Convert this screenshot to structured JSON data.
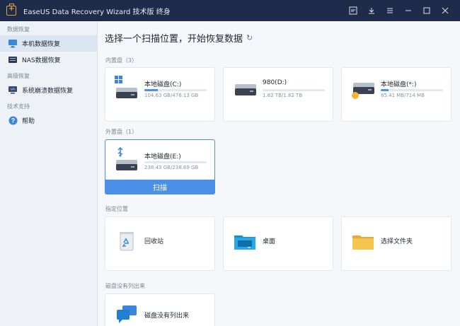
{
  "window": {
    "title": "EaseUS Data Recovery Wizard 技术版 终身",
    "accent": "#4a8fe8"
  },
  "sidebar": {
    "sections": [
      {
        "label": "数据恢复",
        "items": [
          {
            "label": "本机数据恢复",
            "icon": "monitor-icon",
            "active": true
          },
          {
            "label": "NAS数据恢复",
            "icon": "nas-icon",
            "active": false
          }
        ]
      },
      {
        "label": "高级恢复",
        "items": [
          {
            "label": "系统崩溃数据恢复",
            "icon": "pc-crash-icon",
            "active": false
          }
        ]
      },
      {
        "label": "技术支持",
        "items": [
          {
            "label": "帮助",
            "icon": "help-icon",
            "active": false
          }
        ]
      }
    ]
  },
  "main": {
    "title": "选择一个扫描位置，开始恢复数据",
    "internal_label": "内置盘（3）",
    "external_label": "外置盘（1）",
    "locations_label": "指定位置",
    "missing_label": "磁盘没有列出来",
    "scan_label": "扫描",
    "internal_drives": [
      {
        "name": "本地磁盘(C:)",
        "size": "104.63 GB/476.13 GB",
        "fill": 0.22,
        "icon": "windows-drive-icon"
      },
      {
        "name": "980(D:)",
        "size": "1.82 TB/1.82 TB",
        "fill": 0.0,
        "icon": "hdd-icon"
      },
      {
        "name": "本地磁盘(*:)",
        "size": "85.41 MB/714 MB",
        "fill": 0.12,
        "icon": "hdd-warning-icon"
      }
    ],
    "external_drives": [
      {
        "name": "本地磁盘(E:)",
        "size": "238.43 GB/238.69 GB",
        "fill": 0.0,
        "icon": "usb-drive-icon"
      }
    ],
    "locations": [
      {
        "name": "回收站",
        "icon": "recycle-bin-icon"
      },
      {
        "name": "桌面",
        "icon": "desktop-folder-icon"
      },
      {
        "name": "选择文件夹",
        "icon": "folder-icon"
      }
    ],
    "missing": [
      {
        "name": "磁盘没有列出来",
        "icon": "chat-help-icon"
      }
    ]
  }
}
